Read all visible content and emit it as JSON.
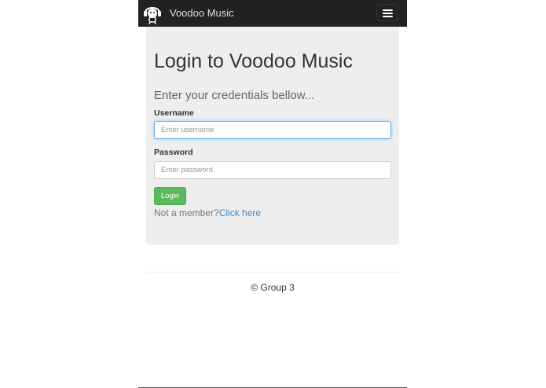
{
  "navbar": {
    "brand_name": "Voodoo Music",
    "logo_icon": "headphones-character-icon",
    "menu_icon": "hamburger-menu-icon",
    "background": "#222222"
  },
  "login": {
    "title": "Login to Voodoo Music",
    "lead": "Enter your credentials bellow...",
    "username_label": "Username",
    "username_placeholder": "Enter username",
    "username_value": "",
    "password_label": "Password",
    "password_placeholder": "Enter password",
    "password_value": "",
    "login_button": "Login",
    "signup_prompt": "Not a member?",
    "signup_link": "Click here"
  },
  "footer": {
    "copyright": "© Group 3"
  },
  "colors": {
    "accent_link": "#428bca",
    "success_button": "#5cb85c",
    "panel_background": "#eeeeee",
    "focus_border": "#66afe9"
  }
}
